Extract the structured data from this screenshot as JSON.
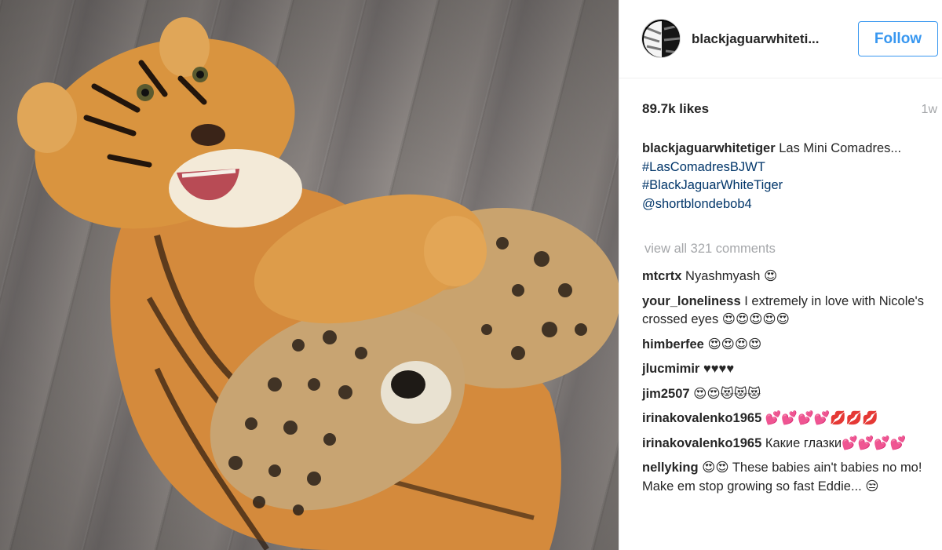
{
  "post": {
    "likes": "89.7k likes",
    "age": "1w",
    "image_alt": "Tiger cub lying on a wooden floor with two jaguar cubs"
  },
  "header": {
    "username": "blackjaguarwhiteti...",
    "follow_label": "Follow"
  },
  "caption": {
    "username": "blackjaguarwhitetiger",
    "text": "Las Mini Comadres...",
    "hashtags": [
      "#LasComadresBJWT",
      "#BlackJaguarWhiteTiger"
    ],
    "mention": "@shortblondebob4"
  },
  "view_all": "view all 321 comments",
  "comments": [
    {
      "user": "mtcrtx",
      "text": "Nyashmyash 😍"
    },
    {
      "user": "your_loneliness",
      "text": "I extremely in love with Nicole's crossed eyes 😍😍😍😍😍"
    },
    {
      "user": "himberfee",
      "text": "😍😍😍😍"
    },
    {
      "user": "jlucmimir",
      "text": "♥♥♥♥"
    },
    {
      "user": "jim2507",
      "text": "😍😍😻😻😻"
    },
    {
      "user": "irinakovalenko1965",
      "text": "💕💕💕💕💋💋💋"
    },
    {
      "user": "irinakovalenko1965",
      "text": "Какие глазки💕💕💕💕"
    },
    {
      "user": "nellyking",
      "text": "😍😍 These babies ain't babies no mo! Make em stop growing so fast Eddie... 😒"
    }
  ]
}
